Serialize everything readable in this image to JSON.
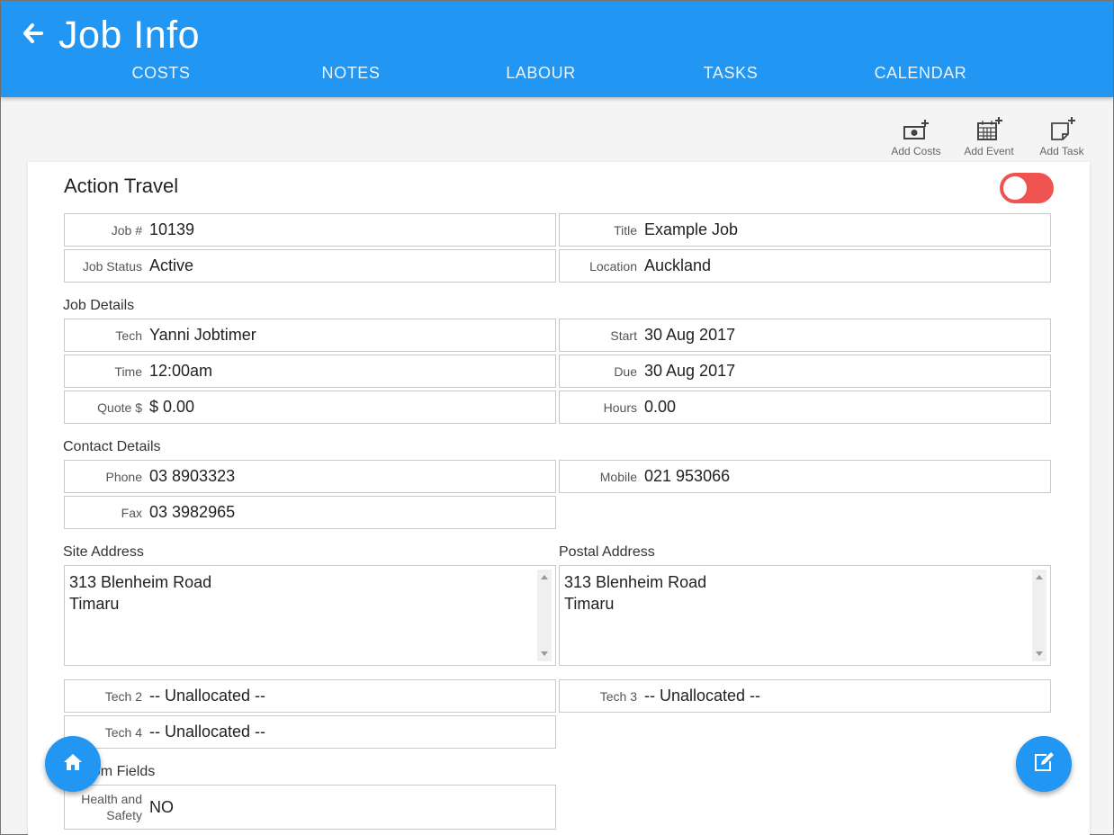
{
  "header": {
    "title": "Job Info",
    "tabs": [
      {
        "label": "COSTS"
      },
      {
        "label": "NOTES"
      },
      {
        "label": "LABOUR"
      },
      {
        "label": "TASKS"
      },
      {
        "label": "CALENDAR"
      }
    ]
  },
  "actions": {
    "add_costs": "Add Costs",
    "add_event": "Add Event",
    "add_task": "Add Task"
  },
  "job": {
    "client": "Action Travel",
    "active_toggle": "on",
    "summary": {
      "job_no_label": "Job #",
      "job_no": "10139",
      "title_label": "Title",
      "title": "Example Job",
      "status_label": "Job Status",
      "status": "Active",
      "location_label": "Location",
      "location": "Auckland"
    },
    "details": {
      "heading": "Job Details",
      "tech_label": "Tech",
      "tech": "Yanni Jobtimer",
      "start_label": "Start",
      "start": "30 Aug 2017",
      "time_label": "Time",
      "time": "12:00am",
      "due_label": "Due",
      "due": "30 Aug 2017",
      "quote_label": "Quote $",
      "quote": "$ 0.00",
      "hours_label": "Hours",
      "hours": "0.00"
    },
    "contact": {
      "heading": "Contact Details",
      "phone_label": "Phone",
      "phone": "03 8903323",
      "mobile_label": "Mobile",
      "mobile": "021 953066",
      "fax_label": "Fax",
      "fax": "03 3982965"
    },
    "address": {
      "site_heading": "Site Address",
      "site": "313 Blenheim Road\nTimaru",
      "postal_heading": "Postal Address",
      "postal": "313 Blenheim Road\nTimaru"
    },
    "techs": {
      "tech2_label": "Tech 2",
      "tech2": "-- Unallocated --",
      "tech3_label": "Tech 3",
      "tech3": "-- Unallocated --",
      "tech4_label": "Tech 4",
      "tech4": "-- Unallocated --"
    },
    "custom": {
      "heading": "om Fields",
      "hs_label": "Health and Safety",
      "hs": "NO"
    }
  },
  "colors": {
    "primary": "#2196f3",
    "toggle": "#ef5350"
  },
  "icons": {
    "back": "arrow-left-icon",
    "home": "home-icon",
    "edit": "edit-icon"
  }
}
